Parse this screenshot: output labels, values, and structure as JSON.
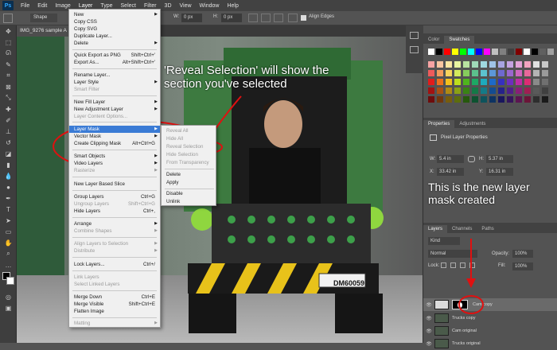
{
  "menubar": {
    "logo": "Ps",
    "items": [
      "File",
      "Edit",
      "Image",
      "Layer",
      "Type",
      "Select",
      "Filter",
      "3D",
      "View",
      "Window",
      "Help"
    ]
  },
  "options_bar": {
    "shape_label": "Shape",
    "w_label": "W:",
    "w_value": "0 px",
    "h_label": "H:",
    "h_value": "0 px",
    "align_edges": "Align Edges"
  },
  "document": {
    "tab_title": "IMG_9276 sample A"
  },
  "layer_menu": {
    "items": [
      {
        "label": "New",
        "sub": true
      },
      {
        "label": "Copy CSS"
      },
      {
        "label": "Copy SVG"
      },
      {
        "label": "Duplicate Layer..."
      },
      {
        "label": "Delete",
        "sub": true
      },
      {
        "label": "Quick Export as PNG",
        "shortcut": "Shift+Ctrl+'"
      },
      {
        "label": "Export As...",
        "shortcut": "Alt+Shift+Ctrl+'"
      },
      {
        "label": "Rename Layer..."
      },
      {
        "label": "Layer Style",
        "sub": true
      },
      {
        "label": "Smart Filter",
        "disabled": true
      },
      {
        "label": "New Fill Layer",
        "sub": true
      },
      {
        "label": "New Adjustment Layer",
        "sub": true
      },
      {
        "label": "Layer Content Options...",
        "disabled": true
      },
      {
        "label": "Layer Mask",
        "sub": true,
        "highlight": true
      },
      {
        "label": "Vector Mask",
        "sub": true
      },
      {
        "label": "Create Clipping Mask",
        "shortcut": "Alt+Ctrl+G"
      },
      {
        "label": "Smart Objects",
        "sub": true
      },
      {
        "label": "Video Layers",
        "sub": true
      },
      {
        "label": "Rasterize",
        "sub": true,
        "disabled": true
      },
      {
        "label": "New Layer Based Slice"
      },
      {
        "label": "Group Layers",
        "shortcut": "Ctrl+G"
      },
      {
        "label": "Ungroup Layers",
        "shortcut": "Shift+Ctrl+G",
        "disabled": true
      },
      {
        "label": "Hide Layers",
        "shortcut": "Ctrl+,"
      },
      {
        "label": "Arrange",
        "sub": true
      },
      {
        "label": "Combine Shapes",
        "sub": true,
        "disabled": true
      },
      {
        "label": "Align Layers to Selection",
        "sub": true,
        "disabled": true
      },
      {
        "label": "Distribute",
        "sub": true,
        "disabled": true
      },
      {
        "label": "Lock Layers...",
        "shortcut": "Ctrl+/"
      },
      {
        "label": "Link Layers",
        "disabled": true
      },
      {
        "label": "Select Linked Layers",
        "disabled": true
      },
      {
        "label": "Merge Down",
        "shortcut": "Ctrl+E"
      },
      {
        "label": "Merge Visible",
        "shortcut": "Shift+Ctrl+E"
      },
      {
        "label": "Flatten Image"
      },
      {
        "label": "Matting",
        "sub": true,
        "disabled": true
      }
    ]
  },
  "layer_mask_submenu": {
    "items": [
      {
        "label": "Reveal All",
        "disabled": true
      },
      {
        "label": "Hide All",
        "disabled": true
      },
      {
        "label": "Reveal Selection",
        "disabled": true
      },
      {
        "label": "Hide Selection",
        "disabled": true
      },
      {
        "label": "From Transparency",
        "disabled": true
      },
      {
        "label": "Delete"
      },
      {
        "label": "Apply"
      },
      {
        "label": "Disable"
      },
      {
        "label": "Unlink"
      }
    ]
  },
  "annotations": {
    "reveal": "'Reveal Selection' will show the section you've selected",
    "mask": "This is the new layer mask created"
  },
  "color_panel": {
    "tabs": [
      "Color",
      "Swatches"
    ]
  },
  "properties_panel": {
    "tabs": [
      "Properties",
      "Adjustments"
    ],
    "title": "Pixel Layer Properties",
    "w_label": "W:",
    "w_value": "5.4 in",
    "h_label": "H:",
    "h_value": "5.37 in",
    "x_label": "X:",
    "x_value": "33.42 in",
    "y_label": "Y:",
    "y_value": "16.31 in"
  },
  "layers_panel": {
    "tabs": [
      "Layers",
      "Channels",
      "Paths"
    ],
    "filter": "Kind",
    "blend_mode": "Normal",
    "opacity_label": "Opacity:",
    "opacity_value": "100%",
    "lock_label": "Lock:",
    "fill_label": "Fill:",
    "fill_value": "100%",
    "layers": [
      {
        "name": "Cam copy"
      },
      {
        "name": "Trucks copy"
      },
      {
        "name": "Cam original"
      },
      {
        "name": "Trucks original"
      }
    ]
  },
  "photo": {
    "license_plate": "DM60059"
  },
  "colors": {
    "highlight": "#3a7bd5",
    "annotation_red": "#e01010"
  }
}
